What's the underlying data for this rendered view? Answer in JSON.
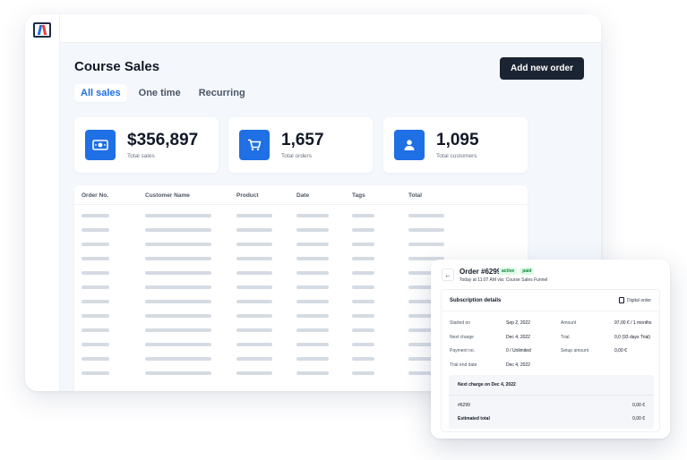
{
  "page": {
    "title": "Course Sales",
    "add_button": "Add new order"
  },
  "tabs": [
    {
      "label": "All sales",
      "active": true
    },
    {
      "label": "One time",
      "active": false
    },
    {
      "label": "Recurring",
      "active": false
    }
  ],
  "stats": [
    {
      "value": "$356,897",
      "label": "Total sales",
      "icon": "money-icon"
    },
    {
      "value": "1,657",
      "label": "Total orders",
      "icon": "cart-icon"
    },
    {
      "value": "1,095",
      "label": "Total customers",
      "icon": "user-icon"
    }
  ],
  "table": {
    "columns": [
      "Order No.",
      "Customer Name",
      "Product",
      "Date",
      "Tags",
      "Total"
    ],
    "placeholder_rows": 12
  },
  "order": {
    "title": "Order #6299",
    "badges": [
      "active",
      "paid"
    ],
    "subtitle": "Today at 11:07 AM via: Course Sales Funnel",
    "section_title": "Subscription details",
    "digital_label": "Digital order",
    "details_left": [
      {
        "label": "Started on",
        "value": "Sep 2, 2022"
      },
      {
        "label": "Next charge",
        "value": "Dec 4, 2022"
      },
      {
        "label": "Payment no.",
        "value": "0 / Unlimited"
      },
      {
        "label": "Trial end date",
        "value": "Dec 4, 2022"
      }
    ],
    "details_right": [
      {
        "label": "Amount",
        "value": "97,00 € / 1 months"
      },
      {
        "label": "Trial",
        "value": "0,0 (93 days Trial)"
      },
      {
        "label": "Setup amount",
        "value": "0,00 €"
      }
    ],
    "next_charge_title": "Next charge on Dec 4, 2022",
    "line_item": {
      "label": "#6299",
      "value": "0,00 €"
    },
    "estimated_total": {
      "label": "Estimated total",
      "value": "0,00 €"
    }
  },
  "colors": {
    "accent": "#1f6fe5",
    "dark_button": "#1b2432",
    "content_bg": "#f4f8fd",
    "badge_green": "#15803d"
  }
}
